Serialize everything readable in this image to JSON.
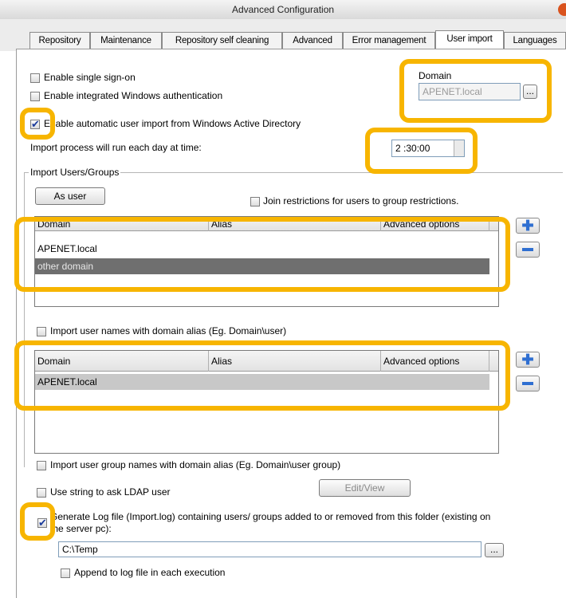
{
  "window": {
    "title": "Advanced Configuration"
  },
  "tabs": [
    {
      "label": "Repository",
      "active": false
    },
    {
      "label": "Maintenance",
      "active": false
    },
    {
      "label": "Repository self cleaning",
      "active": false
    },
    {
      "label": "Advanced",
      "active": false
    },
    {
      "label": "Error management",
      "active": false
    },
    {
      "label": "User import",
      "active": true
    },
    {
      "label": "Languages",
      "active": false
    }
  ],
  "options": {
    "single_sign_on": {
      "label": "Enable single sign-on",
      "checked": false
    },
    "windows_auth": {
      "label": "Enable integrated Windows authentication",
      "checked": false
    },
    "auto_import": {
      "label": "Enable automatic user import from Windows Active Directory",
      "checked": true
    },
    "import_time_label": "Import process will run each day at time:",
    "import_time_value": "2 :30:00"
  },
  "domain": {
    "label": "Domain",
    "value": "APENET.local",
    "browse_label": "..."
  },
  "import_group": {
    "title": "Import Users/Groups",
    "as_user_label": "As user",
    "join_restrictions": {
      "label": "Join restrictions for users to group restrictions.",
      "checked": false
    },
    "grid1": {
      "columns": [
        "Domain",
        "Alias",
        "Advanced options"
      ],
      "rows": [
        {
          "domain": "APENET.local",
          "alias": "",
          "options": "",
          "selected": false
        },
        {
          "domain": "other domain",
          "alias": "",
          "options": "",
          "selected": true
        }
      ]
    },
    "domain_alias": {
      "label": "Import user names with domain alias (Eg. Domain\\user)",
      "checked": false
    },
    "grid2": {
      "columns": [
        "Domain",
        "Alias",
        "Advanced options"
      ],
      "rows": [
        {
          "domain": "APENET.local",
          "alias": "",
          "options": "",
          "selected": true
        }
      ]
    }
  },
  "group_alias": {
    "label": "Import user group names with domain alias (Eg. Domain\\user group)",
    "checked": false
  },
  "ldap": {
    "label": "Use string to ask LDAP user",
    "checked": false,
    "edit_label": "Edit/View"
  },
  "log": {
    "label_line1": "Generate Log file (Import.log) containing users/ groups added to or removed from this folder (existing on",
    "label_line2": "the server pc):",
    "checked": true,
    "path": "C:\\Temp",
    "browse_label": "...",
    "append": {
      "label": "Append to log file in each execution",
      "checked": false
    }
  },
  "colors": {
    "highlight": "#f7b500",
    "selected_row": "#6f6f6f",
    "selected_row_light": "#c8c8c8",
    "icon_blue": "#2f6fd1"
  }
}
